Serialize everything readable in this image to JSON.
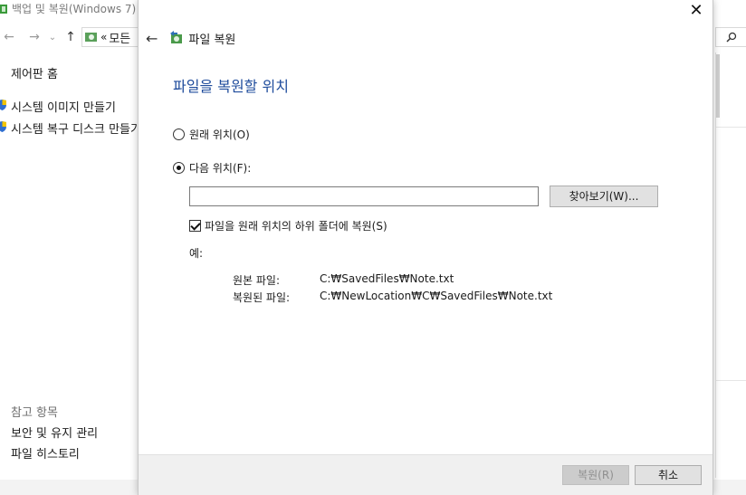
{
  "background_window": {
    "title": "백업 및 복원(Windows 7)",
    "address_chevron": "«",
    "address_text": "모든",
    "sidebar": {
      "home_link": "제어판 홈",
      "tasks": [
        "시스템 이미지 만들기",
        "시스템 복구 디스크 만들기"
      ],
      "see_also_heading": "참고 항목",
      "see_also_links": [
        "보안 및 유지 관리",
        "파일 히스토리"
      ]
    }
  },
  "dialog": {
    "close_glyph": "✕",
    "back_glyph": "←",
    "header_title": "파일 복원",
    "instruction": "파일을 복원할 위치",
    "options": {
      "original_location": "원래 위치(O)",
      "following_location": "다음 위치(F):"
    },
    "path_input": {
      "value": "",
      "placeholder": ""
    },
    "browse_button": "찾아보기(W)...",
    "subfolder_checkbox": "파일을 원래 위치의 하위 폴더에 복원(S)",
    "example_label": "예:",
    "example": {
      "original_label": "원본 파일:",
      "original_value": "C:₩SavedFiles₩Note.txt",
      "restored_label": "복원된 파일:",
      "restored_value": "C:₩NewLocation₩C₩SavedFiles₩Note.txt"
    },
    "restore_button": "복원(R)",
    "cancel_button": "취소"
  },
  "colors": {
    "instruction_blue": "#1f4c9c",
    "button_face": "#e1e1e1",
    "footer_bg": "#f0f0f0"
  }
}
